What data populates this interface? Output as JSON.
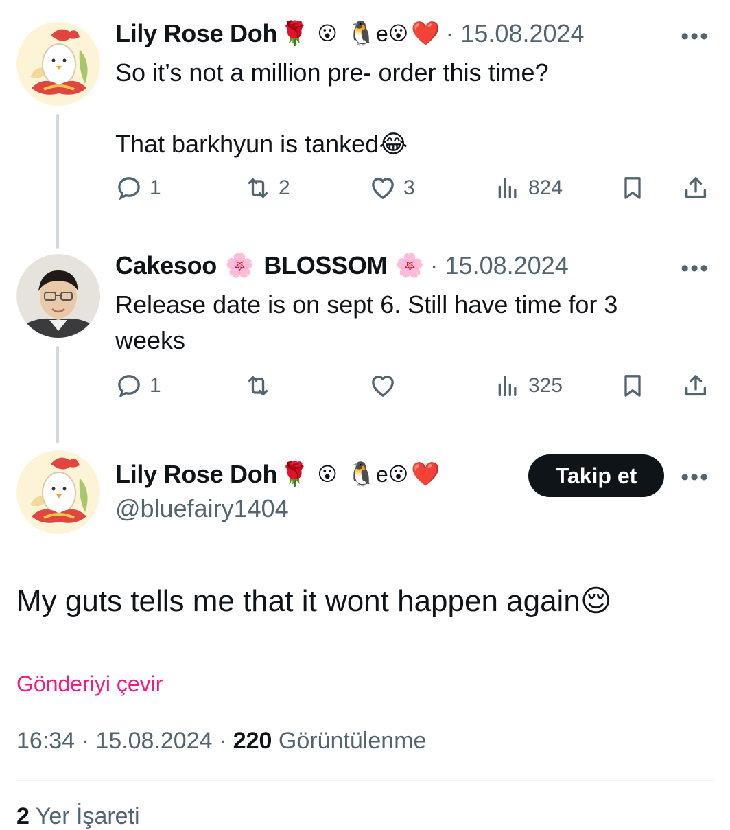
{
  "tweets": [
    {
      "name": "Lily Rose Doh",
      "emojis": [
        "🌹",
        "😮",
        "🐧",
        "e",
        "😮",
        "❤️"
      ],
      "date": "· 15.08.2024",
      "text": "So it’s not a million pre- order this time?\n\nThat barkhyun is tanked😂",
      "reply_count": "1",
      "retweet_count": "2",
      "like_count": "3",
      "view_count": "824"
    },
    {
      "name": "Cakesoo",
      "emoji_left": "🌸",
      "name_suffix": "BLOSSOM",
      "emoji_right": "🌸",
      "date": "· 15.08.2024",
      "text": "Release date is on sept 6. Still have time for 3\nweeks",
      "reply_count": "1",
      "retweet_count": "",
      "like_count": "",
      "view_count": "325"
    }
  ],
  "main_post": {
    "name": "Lily Rose Doh",
    "emojis": [
      "🌹",
      "😮",
      "🐧",
      "e",
      "😮",
      "❤️"
    ],
    "handle": "@bluefairy1404",
    "follow_label": "Takip et",
    "text": "My guts tells me that it wont happen again😌",
    "translate_label": "Gönderiyi çevir",
    "time": "16:34",
    "date": "15.08.2024",
    "separator": "·",
    "views_count": "220",
    "views_label": "Görüntülenme",
    "bookmarks_count": "2",
    "bookmarks_label": "Yer İşareti"
  },
  "more_label": "•••",
  "colors": {
    "text": "#0f1419",
    "secondary": "#536471",
    "accent_pink": "#f91880",
    "thread_line": "#cfd9de",
    "button_bg": "#0f1419"
  }
}
